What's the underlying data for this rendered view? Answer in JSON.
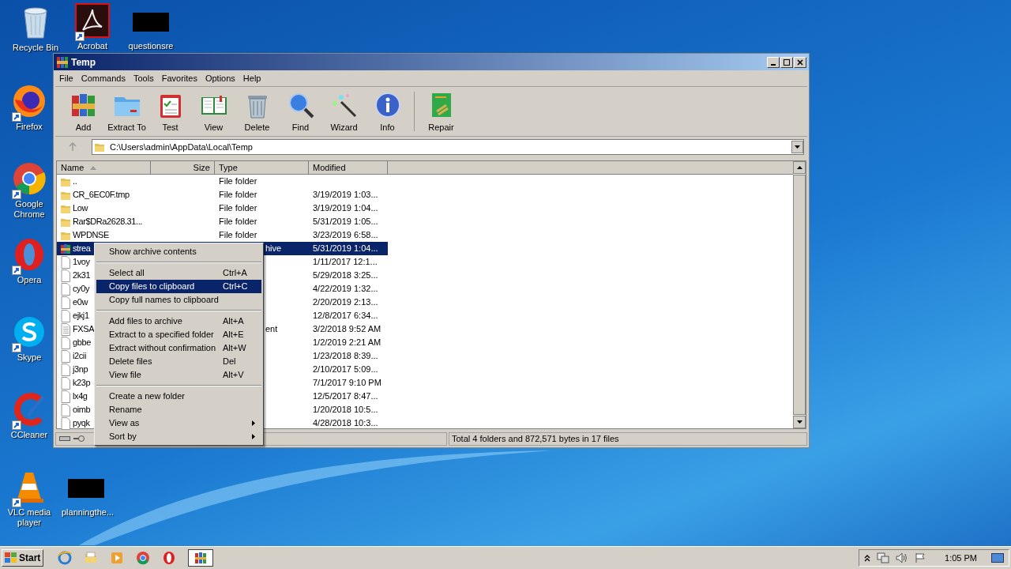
{
  "desktop_icons": [
    {
      "label": "Recycle Bin",
      "kind": "trash"
    },
    {
      "label": "Acrobat",
      "kind": "pdf"
    },
    {
      "label": "questionsre",
      "kind": "blank"
    },
    {
      "label": "Firefox",
      "kind": "firefox"
    },
    {
      "label": "Google Chrome",
      "kind": "chrome"
    },
    {
      "label": "Opera",
      "kind": "opera"
    },
    {
      "label": "Skype",
      "kind": "skype"
    },
    {
      "label": "CCleaner",
      "kind": "ccleaner"
    },
    {
      "label": "VLC media player",
      "kind": "vlc"
    },
    {
      "label": "planningthe...",
      "kind": "blank"
    }
  ],
  "window": {
    "title": "Temp",
    "menu": [
      "File",
      "Commands",
      "Tools",
      "Favorites",
      "Options",
      "Help"
    ],
    "toolbar": [
      {
        "label": "Add",
        "kind": "add"
      },
      {
        "label": "Extract To",
        "kind": "extract"
      },
      {
        "label": "Test",
        "kind": "test"
      },
      {
        "label": "View",
        "kind": "view"
      },
      {
        "label": "Delete",
        "kind": "delete"
      },
      {
        "label": "Find",
        "kind": "find"
      },
      {
        "label": "Wizard",
        "kind": "wizard"
      },
      {
        "label": "Info",
        "kind": "info"
      },
      {
        "label": "Repair",
        "kind": "repair"
      }
    ],
    "address": "C:\\Users\\admin\\AppData\\Local\\Temp",
    "columns": [
      {
        "label": "Name",
        "sorted": true
      },
      {
        "label": "Size",
        "sorted": false
      },
      {
        "label": "Type",
        "sorted": false
      },
      {
        "label": "Modified",
        "sorted": false
      }
    ],
    "rows": [
      {
        "kind": "folder",
        "name": "..",
        "type": "File folder",
        "selected": false
      },
      {
        "kind": "folder",
        "name": "CR_6EC0F.tmp",
        "type": "File folder",
        "modified": "3/19/2019 1:03...",
        "selected": false
      },
      {
        "kind": "folder",
        "name": "Low",
        "type": "File folder",
        "modified": "3/19/2019 1:04...",
        "selected": false
      },
      {
        "kind": "folder",
        "name": "Rar$DRa2628.31...",
        "type": "File folder",
        "modified": "5/31/2019 1:05...",
        "selected": false
      },
      {
        "kind": "folder",
        "name": "WPDNSE",
        "type": "File folder",
        "modified": "3/23/2019 6:58...",
        "selected": false
      },
      {
        "kind": "archive",
        "name": "strea",
        "type_tail": "hive",
        "modified": "5/31/2019 1:04...",
        "selected": true
      },
      {
        "kind": "file",
        "name": "1voy",
        "modified": "1/11/2017 12:1...",
        "selected": false
      },
      {
        "kind": "file",
        "name": "2k31",
        "modified": "5/29/2018 3:25...",
        "selected": false
      },
      {
        "kind": "file",
        "name": "cy0y",
        "modified": "4/22/2019 1:32...",
        "selected": false
      },
      {
        "kind": "file",
        "name": "e0w",
        "modified": "2/20/2019 2:13...",
        "selected": false
      },
      {
        "kind": "file",
        "name": "ejkj1",
        "modified": "12/8/2017 6:34...",
        "selected": false
      },
      {
        "kind": "text",
        "name": "FXSA",
        "type_tail": "ent",
        "modified": "3/2/2018 9:52 AM",
        "selected": false
      },
      {
        "kind": "file",
        "name": "gbbe",
        "modified": "1/2/2019 2:21 AM",
        "selected": false
      },
      {
        "kind": "file",
        "name": "i2cii",
        "modified": "1/23/2018 8:39...",
        "selected": false
      },
      {
        "kind": "file",
        "name": "j3np",
        "modified": "2/10/2017 5:09...",
        "selected": false
      },
      {
        "kind": "file",
        "name": "k23p",
        "modified": "7/1/2017 9:10 PM",
        "selected": false
      },
      {
        "kind": "file",
        "name": "lx4g",
        "modified": "12/5/2017 8:47...",
        "selected": false
      },
      {
        "kind": "file",
        "name": "oimb",
        "modified": "1/20/2018 10:5...",
        "selected": false
      },
      {
        "kind": "file",
        "name": "pyqk",
        "modified": "4/28/2018 10:3...",
        "selected": false
      }
    ],
    "status": "Total 4 folders and 872,571 bytes in 17 files"
  },
  "context_menu": [
    [
      {
        "label": "Show archive contents",
        "selected": false,
        "submenu": false
      }
    ],
    [
      {
        "label": "Select all",
        "shortcut": "Ctrl+A",
        "selected": false,
        "submenu": false
      },
      {
        "label": "Copy files to clipboard",
        "shortcut": "Ctrl+C",
        "selected": true,
        "submenu": false
      },
      {
        "label": "Copy full names to clipboard",
        "selected": false,
        "submenu": false
      }
    ],
    [
      {
        "label": "Add files to archive",
        "shortcut": "Alt+A",
        "selected": false,
        "submenu": false
      },
      {
        "label": "Extract to a specified folder",
        "shortcut": "Alt+E",
        "selected": false,
        "submenu": false
      },
      {
        "label": "Extract without confirmation",
        "shortcut": "Alt+W",
        "selected": false,
        "submenu": false
      },
      {
        "label": "Delete files",
        "shortcut": "Del",
        "selected": false,
        "submenu": false
      },
      {
        "label": "View file",
        "shortcut": "Alt+V",
        "selected": false,
        "submenu": false
      }
    ],
    [
      {
        "label": "Create a new folder",
        "selected": false,
        "submenu": false
      },
      {
        "label": "Rename",
        "selected": false,
        "submenu": false
      },
      {
        "label": "View as",
        "selected": false,
        "submenu": true
      },
      {
        "label": "Sort by",
        "selected": false,
        "submenu": true
      }
    ]
  ],
  "taskbar": {
    "start": "Start",
    "apps": [
      {
        "kind": "ie",
        "active": false
      },
      {
        "kind": "explorer",
        "active": false
      },
      {
        "kind": "media",
        "active": false
      },
      {
        "kind": "chrome",
        "active": false
      },
      {
        "kind": "opera",
        "active": false
      },
      {
        "kind": "winrar",
        "active": true
      }
    ],
    "time": "1:05 PM"
  }
}
